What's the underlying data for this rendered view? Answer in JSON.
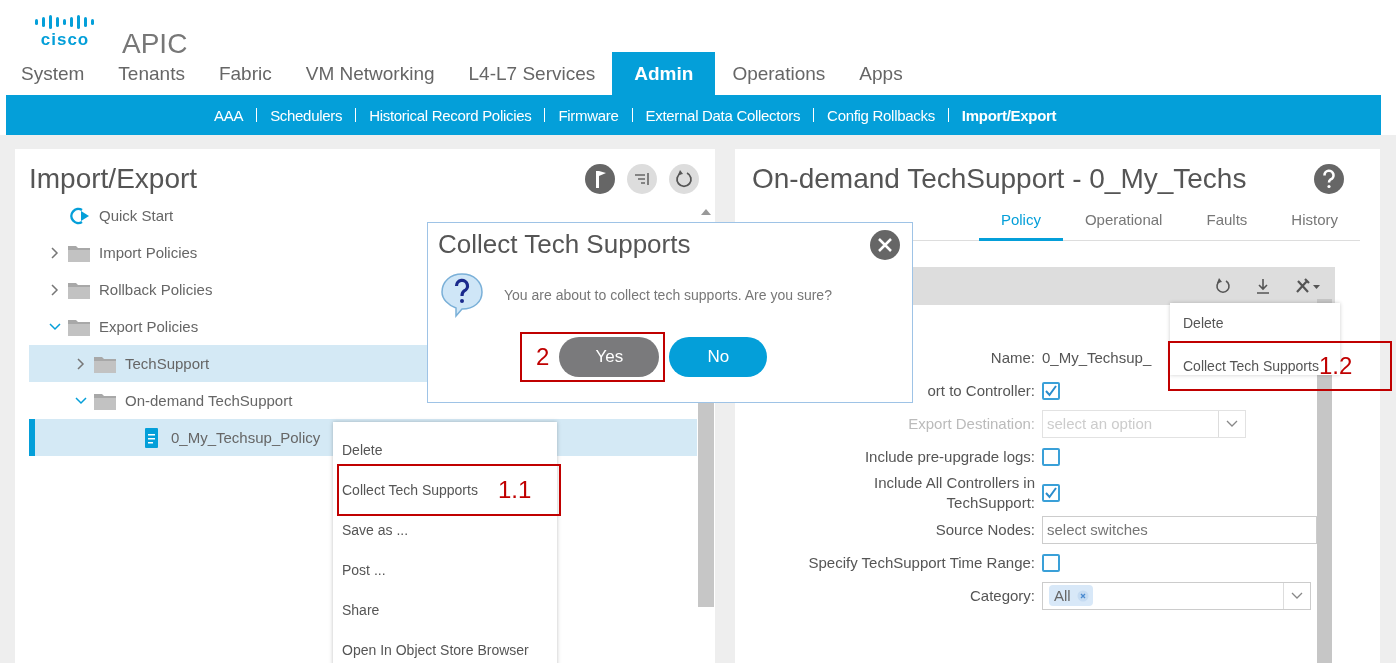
{
  "header": {
    "logo_text": "cisco",
    "product": "APIC"
  },
  "top_tabs": [
    {
      "label": "System",
      "selected": false
    },
    {
      "label": "Tenants",
      "selected": false
    },
    {
      "label": "Fabric",
      "selected": false
    },
    {
      "label": "VM Networking",
      "selected": false
    },
    {
      "label": "L4-L7 Services",
      "selected": false
    },
    {
      "label": "Admin",
      "selected": true
    },
    {
      "label": "Operations",
      "selected": false
    },
    {
      "label": "Apps",
      "selected": false
    }
  ],
  "sub_nav": [
    {
      "label": "AAA",
      "selected": false
    },
    {
      "label": "Schedulers",
      "selected": false
    },
    {
      "label": "Historical Record Policies",
      "selected": false
    },
    {
      "label": "Firmware",
      "selected": false
    },
    {
      "label": "External Data Collectors",
      "selected": false
    },
    {
      "label": "Config Rollbacks",
      "selected": false
    },
    {
      "label": "Import/Export",
      "selected": true
    }
  ],
  "left_panel": {
    "title": "Import/Export",
    "tree": [
      {
        "label": "Quick Start",
        "kind": "start",
        "selected": false,
        "highlighted": false
      },
      {
        "label": "Import Policies",
        "kind": "folder",
        "expanded": false,
        "selected": false,
        "highlighted": false
      },
      {
        "label": "Rollback Policies",
        "kind": "folder",
        "expanded": false,
        "selected": false,
        "highlighted": false
      },
      {
        "label": "Export Policies",
        "kind": "folder",
        "expanded": true,
        "selected": false,
        "highlighted": false,
        "children": [
          {
            "label": "TechSupport",
            "kind": "folder",
            "expanded": false,
            "selected": false,
            "highlighted": true
          },
          {
            "label": "On-demand TechSupport",
            "kind": "folder",
            "expanded": true,
            "selected": false,
            "highlighted": false,
            "children": [
              {
                "label": "0_My_Techsup_Policy",
                "kind": "policy",
                "selected": true,
                "highlighted": true
              }
            ]
          }
        ]
      }
    ]
  },
  "right_panel": {
    "title": "On-demand TechSupport - 0_My_Techs",
    "tabs": [
      {
        "label": "Policy",
        "selected": true
      },
      {
        "label": "Operational",
        "selected": false
      },
      {
        "label": "Faults",
        "selected": false
      },
      {
        "label": "History",
        "selected": false
      }
    ],
    "form": [
      {
        "kind": "text",
        "label": "Name:",
        "value": "0_My_Techsup_",
        "disabled": false
      },
      {
        "kind": "checkbox",
        "label": "ort to Controller:",
        "checked": true,
        "disabled": false
      },
      {
        "kind": "select",
        "label": "Export Destination:",
        "placeholder": "select an option",
        "disabled": true
      },
      {
        "kind": "checkbox",
        "label": "Include pre-upgrade logs:",
        "checked": false,
        "disabled": false
      },
      {
        "kind": "checkbox",
        "label": "Include All Controllers in\nTechSupport:",
        "checked": true,
        "disabled": false
      },
      {
        "kind": "input",
        "label": "Source Nodes:",
        "placeholder": "select switches",
        "disabled": false
      },
      {
        "kind": "checkbox",
        "label": "Specify TechSupport Time Range:",
        "checked": false,
        "disabled": false
      },
      {
        "kind": "tags",
        "label": "Category:",
        "tags": [
          "All"
        ],
        "disabled": false
      }
    ],
    "actions_menu": {
      "items": [
        {
          "label": "Delete"
        },
        {
          "label": "Collect Tech Supports",
          "annotation": "1.2"
        }
      ]
    }
  },
  "context_menu": {
    "items": [
      {
        "label": "Delete"
      },
      {
        "label": "Collect Tech Supports",
        "annotation": "1.1"
      },
      {
        "label": "Save as ..."
      },
      {
        "label": "Post ..."
      },
      {
        "label": "Share"
      },
      {
        "label": "Open In Object Store Browser"
      }
    ]
  },
  "dialog": {
    "title": "Collect Tech Supports",
    "message": "You are about to collect tech supports. Are you sure?",
    "buttons": [
      {
        "label": "Yes",
        "kind": "secondary",
        "annotation": "2"
      },
      {
        "label": "No",
        "kind": "primary"
      }
    ]
  }
}
